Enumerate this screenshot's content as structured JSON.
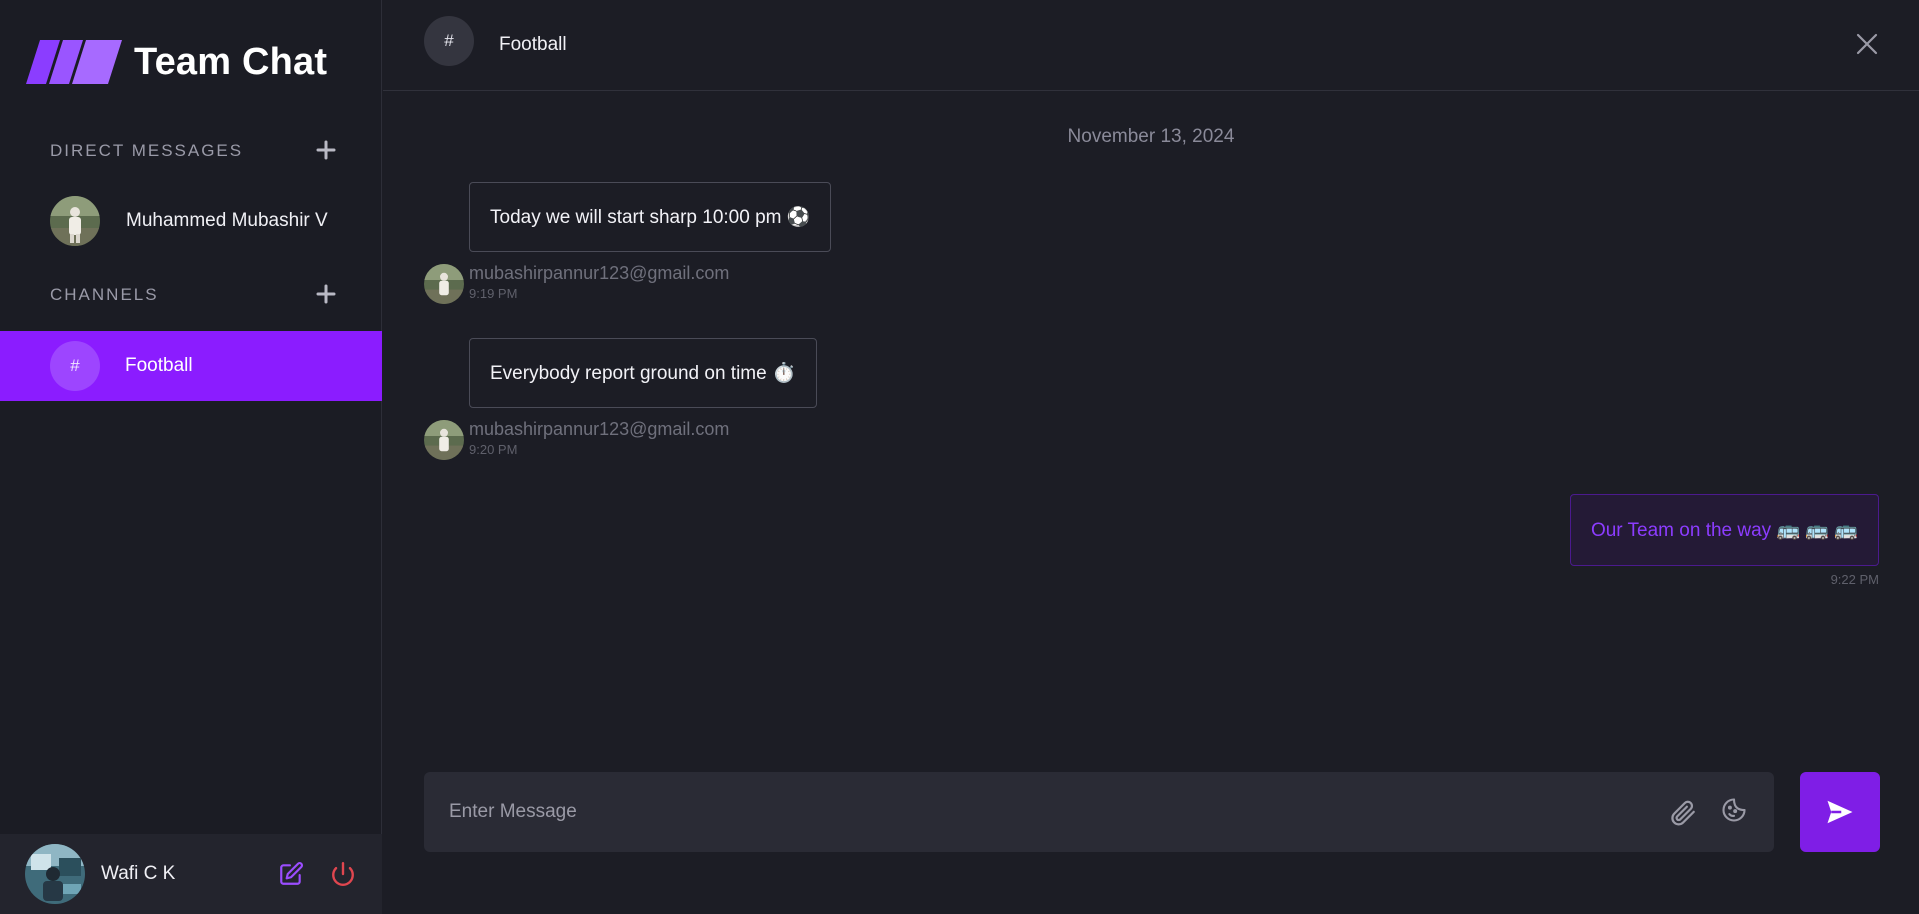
{
  "brand": {
    "title": "Team Chat"
  },
  "sidebar": {
    "direct_messages_label": "DIRECT MESSAGES",
    "channels_label": "CHANNELS",
    "direct_messages": [
      {
        "name": "Muhammed Mubashir V"
      }
    ],
    "channels": [
      {
        "hash": "#",
        "name": "Football",
        "active": true
      }
    ],
    "user": {
      "name": "Wafi C K"
    }
  },
  "header": {
    "hash": "#",
    "title": "Football"
  },
  "chat": {
    "date": "November 13, 2024",
    "messages": [
      {
        "text": "Today we will start sharp 10:00 pm ⚽",
        "sender": "mubashirpannur123@gmail.com",
        "time": "9:19 PM"
      },
      {
        "text": "Everybody report ground on time ⏱️",
        "sender": "mubashirpannur123@gmail.com",
        "time": "9:20 PM"
      }
    ],
    "own_message": {
      "text": "Our Team on the way 🚌 🚌 🚌",
      "time": "9:22 PM"
    }
  },
  "composer": {
    "placeholder": "Enter Message"
  },
  "colors": {
    "accent": "#8b1cff",
    "send_button": "#7f1ee6",
    "logout_icon": "#e0464f",
    "edit_icon": "#9b4dff",
    "background": "#1c1d25"
  },
  "icons": {
    "logo": "parallelogram-stripes-icon",
    "add": "plus-icon",
    "edit": "edit-icon",
    "logout": "power-icon",
    "close": "close-icon",
    "attach": "paperclip-icon",
    "emoji": "emoji-icon",
    "send": "send-icon"
  }
}
